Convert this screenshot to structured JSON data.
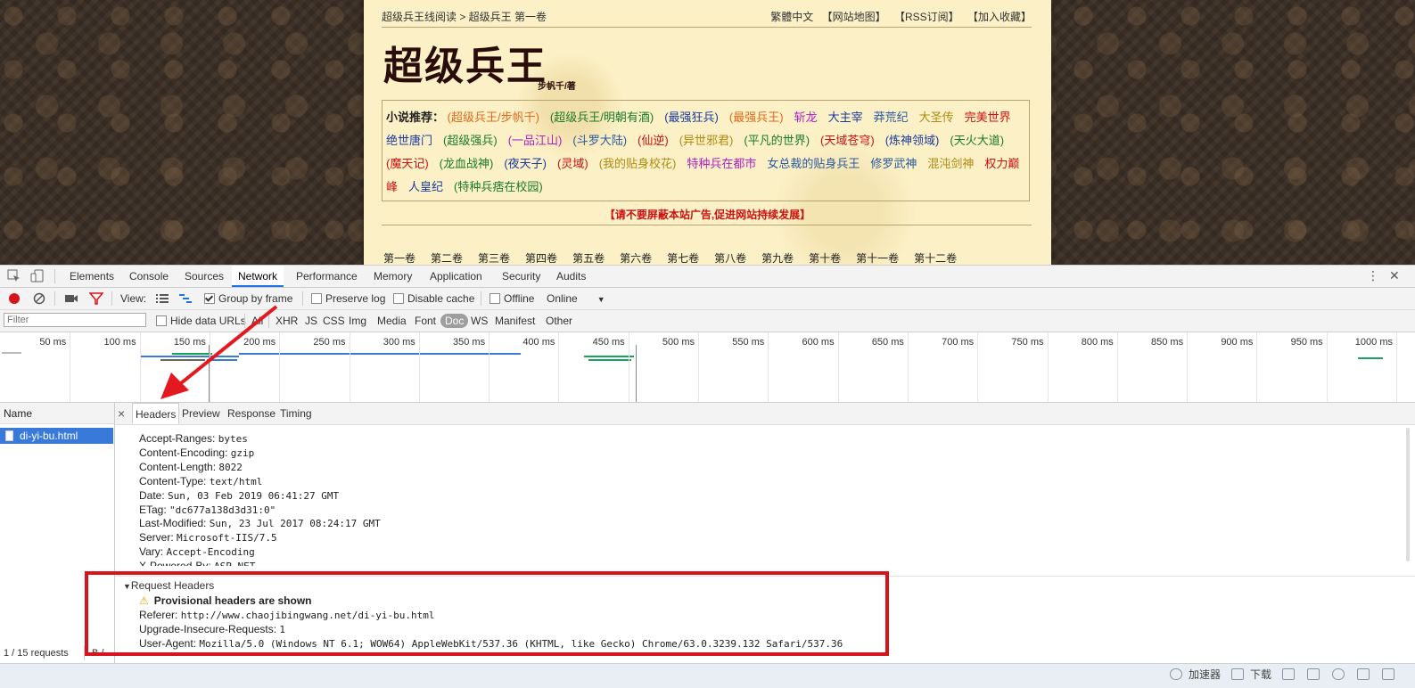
{
  "page": {
    "breadcrumb": "超级兵王线阅读 > 超级兵王 第一卷",
    "top_links": [
      "繁體中文",
      "【网站地图】",
      "【RSS订阅】",
      "【加入收藏】"
    ],
    "title": "超级兵王",
    "author": "步帆千/著",
    "rec_label": "小说推荐：",
    "recommendations": [
      {
        "text": "(超级兵王/步帆千)",
        "color": "#e06a1a"
      },
      {
        "text": "(超级兵王/明朝有酒)",
        "color": "#1a7a2a"
      },
      {
        "text": "(最强狂兵)",
        "color": "#1a3aa0"
      },
      {
        "text": "(最强兵王)",
        "color": "#e06a1a"
      },
      {
        "text": "斩龙",
        "color": "#b020c0"
      },
      {
        "text": "大主宰",
        "color": "#1a3aa0"
      },
      {
        "text": "莽荒纪",
        "color": "#2a5aa0"
      },
      {
        "text": "大圣传",
        "color": "#b08a10"
      },
      {
        "text": "完美世界",
        "color": "#cc1111"
      },
      {
        "text": "绝世唐门",
        "color": "#1a3aa0"
      },
      {
        "text": "(超级强兵)",
        "color": "#1a7a2a"
      },
      {
        "text": "(一品江山)",
        "color": "#b020c0"
      },
      {
        "text": "(斗罗大陆)",
        "color": "#2a5aa0"
      },
      {
        "text": "(仙逆)",
        "color": "#cc1111"
      },
      {
        "text": "(异世邪君)",
        "color": "#b08a10"
      },
      {
        "text": "(平凡的世界)",
        "color": "#1a7a2a"
      },
      {
        "text": "(天域苍穹)",
        "color": "#cc1111"
      },
      {
        "text": "(炼神领域)",
        "color": "#1a3aa0"
      },
      {
        "text": "(天火大道)",
        "color": "#1a7a2a"
      },
      {
        "text": "(魔天记)",
        "color": "#cc1111"
      },
      {
        "text": "(龙血战神)",
        "color": "#1a7a2a"
      },
      {
        "text": "(夜天子)",
        "color": "#1a3aa0"
      },
      {
        "text": "(灵域)",
        "color": "#cc1111"
      },
      {
        "text": "(我的贴身校花)",
        "color": "#b08a10"
      },
      {
        "text": "特种兵在都市",
        "color": "#b020c0"
      },
      {
        "text": "女总裁的贴身兵王",
        "color": "#2a5aa0"
      },
      {
        "text": "修罗武神",
        "color": "#2a5aa0"
      },
      {
        "text": "混沌剑神",
        "color": "#b08a10"
      },
      {
        "text": "权力巅峰",
        "color": "#cc1111"
      },
      {
        "text": "人皇纪",
        "color": "#1a3aa0"
      },
      {
        "text": "(特种兵痞在校园)",
        "color": "#1a7a2a"
      }
    ],
    "notice": "【请不要屏蔽本站广告,促进网站持续发展】",
    "volumes": [
      "第一卷",
      "第二卷",
      "第三卷",
      "第四卷",
      "第五卷",
      "第六卷",
      "第七卷",
      "第八卷",
      "第九卷",
      "第十卷",
      "第十一卷",
      "第十二卷"
    ]
  },
  "devtools": {
    "tabs": [
      "Elements",
      "Console",
      "Sources",
      "Network",
      "Performance",
      "Memory",
      "Application",
      "Security",
      "Audits"
    ],
    "active_tab": "Network",
    "toolbar": {
      "view_label": "View:",
      "group_by_frame": "Group by frame",
      "preserve_log": "Preserve log",
      "disable_cache": "Disable cache",
      "offline": "Offline",
      "throttle": "Online"
    },
    "filter": {
      "placeholder": "Filter",
      "hide_data_urls": "Hide data URLs",
      "types": [
        "All",
        "XHR",
        "JS",
        "CSS",
        "Img",
        "Media",
        "Font",
        "Doc",
        "WS",
        "Manifest",
        "Other"
      ],
      "selected_type": "Doc"
    },
    "timeline_ticks": [
      "50 ms",
      "100 ms",
      "150 ms",
      "200 ms",
      "250 ms",
      "300 ms",
      "350 ms",
      "400 ms",
      "450 ms",
      "500 ms",
      "550 ms",
      "600 ms",
      "650 ms",
      "700 ms",
      "750 ms",
      "800 ms",
      "850 ms",
      "900 ms",
      "950 ms",
      "1000 ms"
    ],
    "name_header": "Name",
    "selected_file": "di-yi-bu.html",
    "status_requests": "1 / 15 requests",
    "status_bytes": "B /...",
    "detail_tabs": [
      "Headers",
      "Preview",
      "Response",
      "Timing"
    ],
    "response_headers": [
      {
        "name": "Accept-Ranges:",
        "value": "bytes"
      },
      {
        "name": "Content-Encoding:",
        "value": "gzip"
      },
      {
        "name": "Content-Length:",
        "value": "8022"
      },
      {
        "name": "Content-Type:",
        "value": "text/html"
      },
      {
        "name": "Date:",
        "value": "Sun, 03 Feb 2019 06:41:27 GMT"
      },
      {
        "name": "ETag:",
        "value": "\"dc677a138d3d31:0\""
      },
      {
        "name": "Last-Modified:",
        "value": "Sun, 23 Jul 2017 08:24:17 GMT"
      },
      {
        "name": "Server:",
        "value": "Microsoft-IIS/7.5"
      },
      {
        "name": "Vary:",
        "value": "Accept-Encoding"
      },
      {
        "name": "X-Powered-By:",
        "value": "ASP.NET"
      }
    ],
    "request_section_title": "Request Headers",
    "provisional_warning": "Provisional headers are shown",
    "request_headers": [
      {
        "name": "Referer:",
        "value": "http://www.chaojibingwang.net/di-yi-bu.html"
      },
      {
        "name": "Upgrade-Insecure-Requests:",
        "value": "1"
      },
      {
        "name": "User-Agent:",
        "value": "Mozilla/5.0 (Windows NT 6.1; WOW64) AppleWebKit/537.36 (KHTML, like Gecko) Chrome/63.0.3239.132 Safari/537.36"
      }
    ]
  },
  "statusbar": {
    "accelerator": "加速器",
    "download": "下载"
  },
  "colors": {
    "highlight_box": "#d6141c",
    "annotation_arrow": "#e3191f",
    "selection": "#3879d9"
  }
}
